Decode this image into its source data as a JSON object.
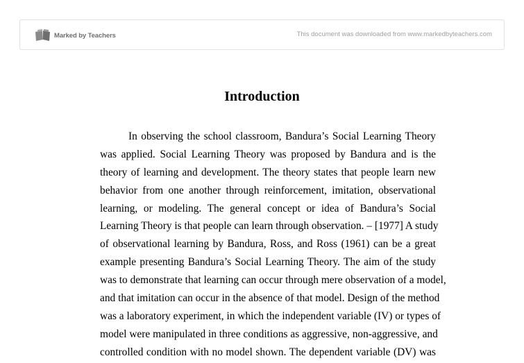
{
  "header": {
    "brand": "Marked by Teachers",
    "logo_icon": "open-book-icon",
    "notice": "This document was downloaded from www.markedbyteachers.com"
  },
  "document": {
    "title": "Introduction",
    "lines": [
      "In observing the school classroom, Bandura’s Social Learning Theory",
      "was applied. Social Learning Theory was proposed by Bandura and is the",
      "theory of learning and development. The theory states that people learn new",
      "behavior from one another through reinforcement, imitation, observational",
      "learning, or modeling. The general concept or idea of Bandura’s Social",
      "Learning Theory is that people can learn through observation. – [1977] A study",
      "of observational learning by Bandura, Ross, and Ross (1961) can be a great",
      "example presenting Bandura’s Social Learning Theory. The aim of the study",
      "was to demonstrate that learning can occur through mere observation of a model,",
      "and that imitation can occur in the absence of that model. Design of the method",
      "was a laboratory experiment, in which the independent variable (IV) or types of",
      "model were manipulated in three conditions as aggressive, non-aggressive, and",
      "controlled condition with no model shown. The dependent variable (DV) was"
    ]
  },
  "colors": {
    "brand_text": "#707070",
    "notice_text": "#a0a0a0",
    "body_text": "#000000"
  }
}
